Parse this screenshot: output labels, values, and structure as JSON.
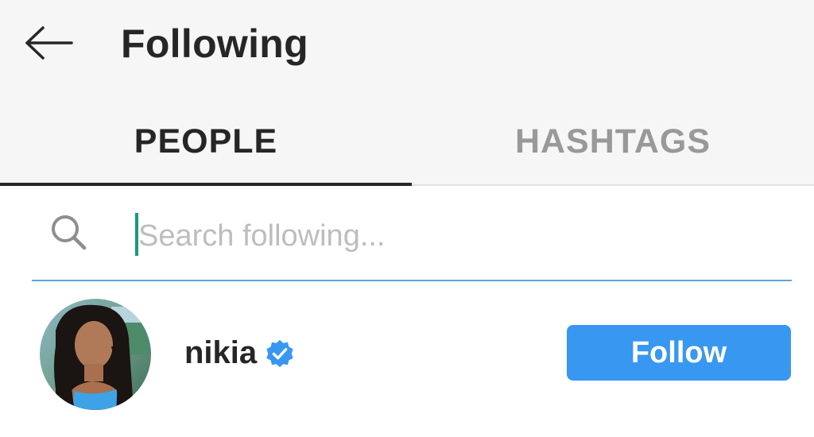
{
  "header": {
    "title": "Following",
    "back_icon": "arrow-left-icon"
  },
  "tabs": [
    {
      "label": "PEOPLE",
      "active": true
    },
    {
      "label": "HASHTAGS",
      "active": false
    }
  ],
  "search": {
    "placeholder": "Search following...",
    "value": "",
    "icon": "search-icon"
  },
  "following": [
    {
      "username": "nikia",
      "verified": true,
      "button_label": "Follow"
    }
  ],
  "colors": {
    "header_bg": "#f6f6f6",
    "text_primary": "#262626",
    "tab_inactive": "#999999",
    "accent_blue": "#3897f0",
    "search_underline": "#58a6e0",
    "cursor": "#1a9a7a"
  }
}
